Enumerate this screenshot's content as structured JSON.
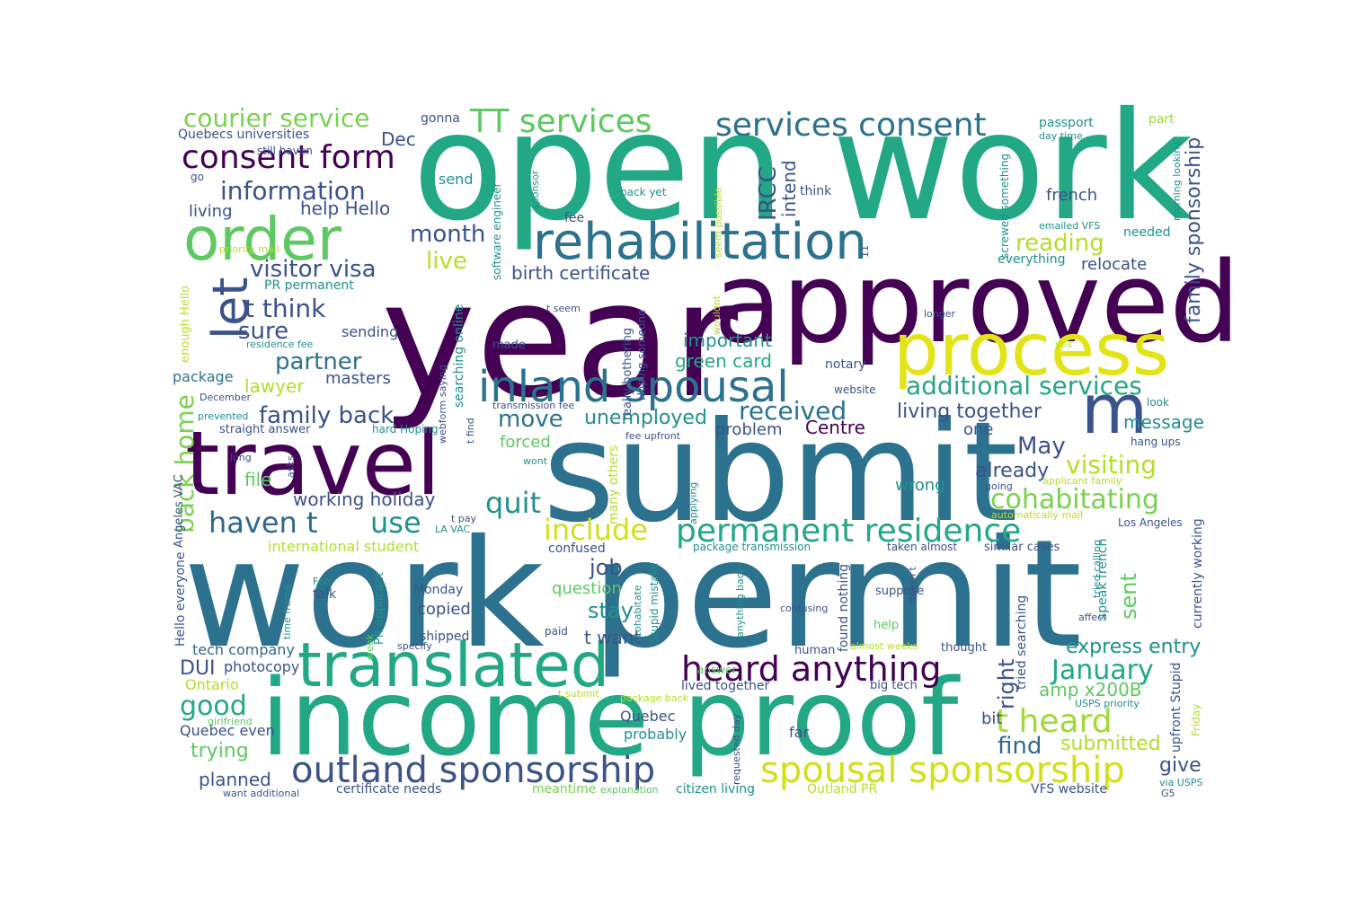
{
  "palette": {
    "dark_purple": "#440154",
    "indigo": "#3b528b",
    "blue": "#31688e",
    "teal": "#21918c",
    "green": "#22a884",
    "light_green": "#5ec962",
    "lime": "#a0da39",
    "yellow": "#e2e418"
  },
  "words": [
    {
      "text": "open work",
      "color": "#22a884"
    },
    {
      "text": "year",
      "color": "#440154"
    },
    {
      "text": "approved",
      "color": "#440154"
    },
    {
      "text": "work permit",
      "color": "#2c728e"
    },
    {
      "text": "submit",
      "color": "#2c728e"
    },
    {
      "text": "income proof",
      "color": "#22a884"
    },
    {
      "text": "travel",
      "color": "#440154"
    },
    {
      "text": "process",
      "color": "#e2e418"
    },
    {
      "text": "translated",
      "color": "#22a884"
    },
    {
      "text": "order",
      "color": "#5ec962"
    },
    {
      "text": "rehabilitation",
      "color": "#2c728e"
    },
    {
      "text": "inland spousal",
      "color": "#2c728e"
    },
    {
      "text": "m",
      "color": "#3b528b"
    },
    {
      "text": "let",
      "color": "#3b528b"
    },
    {
      "text": "spousal sponsorship",
      "color": "#d0e11c"
    },
    {
      "text": "outland sponsorship",
      "color": "#3b528b"
    },
    {
      "text": "heard anything",
      "color": "#440154"
    },
    {
      "text": "permanent residence",
      "color": "#22a884"
    },
    {
      "text": "services consent",
      "color": "#2c728e"
    },
    {
      "text": "TT services",
      "color": "#5ec962"
    },
    {
      "text": "consent form",
      "color": "#440154"
    },
    {
      "text": "courier service",
      "color": "#7ad151"
    },
    {
      "text": "information",
      "color": "#3b528b"
    },
    {
      "text": "additional services",
      "color": "#22a884"
    },
    {
      "text": "haven t",
      "color": "#31688e"
    },
    {
      "text": "use",
      "color": "#21918c"
    },
    {
      "text": "quit",
      "color": "#21918c"
    },
    {
      "text": "include",
      "color": "#d0e11c"
    },
    {
      "text": "cohabitating",
      "color": "#7ad151"
    },
    {
      "text": "visiting",
      "color": "#b5de2b"
    },
    {
      "text": "t heard",
      "color": "#a0da39"
    },
    {
      "text": "January",
      "color": "#22a884"
    },
    {
      "text": "back home",
      "color": "#7ad151"
    },
    {
      "text": "received",
      "color": "#2c728e"
    },
    {
      "text": "move",
      "color": "#2c728e"
    },
    {
      "text": "t think",
      "color": "#3b528b"
    },
    {
      "text": "family back",
      "color": "#3b528b"
    },
    {
      "text": "partner",
      "color": "#2c728e"
    },
    {
      "text": "sure",
      "color": "#3b528b"
    },
    {
      "text": "visitor visa",
      "color": "#3b528b"
    },
    {
      "text": "month",
      "color": "#3b528b"
    },
    {
      "text": "live",
      "color": "#b5de2b"
    },
    {
      "text": "reading",
      "color": "#b5de2b"
    },
    {
      "text": "IRCC",
      "color": "#3b528b"
    },
    {
      "text": "family sponsorship",
      "color": "#3b528b"
    },
    {
      "text": "living together",
      "color": "#3b528b"
    },
    {
      "text": "unemployed",
      "color": "#21918c"
    },
    {
      "text": "May",
      "color": "#3b528b"
    },
    {
      "text": "good",
      "color": "#22a884"
    },
    {
      "text": "right",
      "color": "#3b528b"
    },
    {
      "text": "find",
      "color": "#31688e"
    },
    {
      "text": "job",
      "color": "#3b528b"
    },
    {
      "text": "stay",
      "color": "#21918c"
    },
    {
      "text": "sent",
      "color": "#5ec962"
    },
    {
      "text": "trying",
      "color": "#5ec962"
    },
    {
      "text": "give",
      "color": "#3b528b"
    },
    {
      "text": "already",
      "color": "#3b528b"
    },
    {
      "text": "express entry",
      "color": "#21918c"
    },
    {
      "text": "submitted",
      "color": "#b5de2b"
    },
    {
      "text": "amp x200B",
      "color": "#5ec962"
    },
    {
      "text": "working holiday",
      "color": "#3b528b"
    },
    {
      "text": "birth certificate",
      "color": "#3b528b"
    },
    {
      "text": "green card",
      "color": "#22a884"
    },
    {
      "text": "important",
      "color": "#21918c"
    },
    {
      "text": "DUI",
      "color": "#3b528b"
    },
    {
      "text": "planned",
      "color": "#3b528b"
    },
    {
      "text": "Dec",
      "color": "#3b528b"
    },
    {
      "text": "help Hello",
      "color": "#3b528b"
    },
    {
      "text": "intend",
      "color": "#3b528b"
    },
    {
      "text": "french",
      "color": "#3b528b"
    },
    {
      "text": "relocate",
      "color": "#3b528b"
    },
    {
      "text": "message",
      "color": "#21918c"
    },
    {
      "text": "lawyer",
      "color": "#b5de2b"
    },
    {
      "text": "file",
      "color": "#5ec962"
    },
    {
      "text": "t want",
      "color": "#3b528b"
    },
    {
      "text": "problem",
      "color": "#3b528b"
    },
    {
      "text": "Centre",
      "color": "#440154"
    },
    {
      "text": "copied",
      "color": "#3b528b"
    },
    {
      "text": "forced",
      "color": "#5ec962"
    },
    {
      "text": "question",
      "color": "#5ec962"
    },
    {
      "text": "living",
      "color": "#3b528b"
    },
    {
      "text": "masters",
      "color": "#3b528b"
    },
    {
      "text": "wrong",
      "color": "#21918c"
    },
    {
      "text": "one",
      "color": "#3b528b"
    },
    {
      "text": "bit",
      "color": "#3b528b"
    },
    {
      "text": "sending",
      "color": "#3b528b"
    },
    {
      "text": "package",
      "color": "#2c728e"
    },
    {
      "text": "photocopy",
      "color": "#3b528b"
    },
    {
      "text": "tech company",
      "color": "#31688e"
    },
    {
      "text": "Ontario",
      "color": "#b5de2b"
    },
    {
      "text": "Quebec even",
      "color": "#3b528b"
    },
    {
      "text": "Quebec",
      "color": "#3b528b"
    },
    {
      "text": "probably",
      "color": "#21918c"
    },
    {
      "text": "far",
      "color": "#3b528b"
    },
    {
      "text": "certificate needs",
      "color": "#3b528b"
    },
    {
      "text": "meantime",
      "color": "#7ad151"
    },
    {
      "text": "VFS website",
      "color": "#3b528b"
    },
    {
      "text": "Outland PR",
      "color": "#b5de2b"
    },
    {
      "text": "citizen living",
      "color": "#21918c"
    },
    {
      "text": "international student",
      "color": "#b5de2b"
    },
    {
      "text": "confused",
      "color": "#3b528b"
    },
    {
      "text": "Monday",
      "color": "#3b528b"
    },
    {
      "text": "shipped",
      "color": "#3b528b"
    },
    {
      "text": "talk",
      "color": "#3b528b"
    },
    {
      "text": "Hello everyone",
      "color": "#3b528b"
    },
    {
      "text": "Quebecs universities",
      "color": "#3b528b"
    },
    {
      "text": "gonna",
      "color": "#3b528b"
    },
    {
      "text": "send",
      "color": "#21918c"
    },
    {
      "text": "still haven",
      "color": "#3b528b"
    },
    {
      "text": "go",
      "color": "#3b528b"
    },
    {
      "text": "PR permanent",
      "color": "#21918c"
    },
    {
      "text": "passport",
      "color": "#21918c"
    },
    {
      "text": "part",
      "color": "#a0da39"
    },
    {
      "text": "day time",
      "color": "#21918c"
    },
    {
      "text": "think",
      "color": "#3b528b"
    },
    {
      "text": "fee",
      "color": "#3b528b"
    },
    {
      "text": "back yet",
      "color": "#21918c"
    },
    {
      "text": "needed",
      "color": "#21918c"
    },
    {
      "text": "everything",
      "color": "#21918c"
    },
    {
      "text": "emailed VFS",
      "color": "#21918c"
    },
    {
      "text": "notary",
      "color": "#3b528b"
    },
    {
      "text": "website",
      "color": "#3b528b"
    },
    {
      "text": "look",
      "color": "#21918c"
    },
    {
      "text": "hang ups",
      "color": "#3b528b"
    },
    {
      "text": "straight answer",
      "color": "#3b528b"
    },
    {
      "text": "hard Hoping",
      "color": "#21918c"
    },
    {
      "text": "transmission fee",
      "color": "#3b528b"
    },
    {
      "text": "fee upfront",
      "color": "#3b528b"
    },
    {
      "text": "Los Angeles",
      "color": "#3b528b"
    },
    {
      "text": "similar cases",
      "color": "#3b528b"
    },
    {
      "text": "taken almost",
      "color": "#3b528b"
    },
    {
      "text": "package transmission",
      "color": "#21918c"
    },
    {
      "text": "suppose",
      "color": "#3b528b"
    },
    {
      "text": "help",
      "color": "#5ec962"
    },
    {
      "text": "human",
      "color": "#3b528b"
    },
    {
      "text": "thought",
      "color": "#3b528b"
    },
    {
      "text": "answer",
      "color": "#5ec962"
    },
    {
      "text": "lived together",
      "color": "#3b528b"
    },
    {
      "text": "big tech",
      "color": "#3b528b"
    },
    {
      "text": "almost weeks",
      "color": "#b5de2b"
    },
    {
      "text": "confusing",
      "color": "#3b528b"
    },
    {
      "text": "explanation",
      "color": "#5ec962"
    },
    {
      "text": "residence fee",
      "color": "#21918c"
    },
    {
      "text": "December",
      "color": "#3b528b"
    },
    {
      "text": "prevented",
      "color": "#21918c"
    },
    {
      "text": "priority mail",
      "color": "#b5de2b"
    },
    {
      "text": "paid",
      "color": "#3b528b"
    },
    {
      "text": "wont",
      "color": "#21918c"
    },
    {
      "text": "applicant family",
      "color": "#b5de2b"
    },
    {
      "text": "going",
      "color": "#3b528b"
    },
    {
      "text": "automatically mail",
      "color": "#b5de2b"
    },
    {
      "text": "yes",
      "color": "#b5de2b"
    },
    {
      "text": "longer",
      "color": "#3b528b"
    },
    {
      "text": "t seem",
      "color": "#3b528b"
    },
    {
      "text": "made",
      "color": "#3b528b"
    },
    {
      "text": "t pay",
      "color": "#3b528b"
    },
    {
      "text": "LA VAC",
      "color": "#21918c"
    },
    {
      "text": "Angeles VAC",
      "color": "#3b528b"
    },
    {
      "text": "long",
      "color": "#3b528b"
    },
    {
      "text": "girlfriend",
      "color": "#5ec962"
    },
    {
      "text": "want additional",
      "color": "#3b528b"
    },
    {
      "text": "t submit",
      "color": "#b5de2b"
    },
    {
      "text": "package back",
      "color": "#b5de2b"
    },
    {
      "text": "specify",
      "color": "#3b528b"
    },
    {
      "text": "Feb",
      "color": "#21918c"
    },
    {
      "text": "affect",
      "color": "#3b528b"
    },
    {
      "text": "USPS priority",
      "color": "#21918c"
    },
    {
      "text": "via USPS",
      "color": "#21918c"
    },
    {
      "text": "G5",
      "color": "#3b528b"
    },
    {
      "text": "enough Hello",
      "color": "#b5de2b"
    },
    {
      "text": "webform saying",
      "color": "#3b528b"
    },
    {
      "text": "searching online",
      "color": "#21918c"
    },
    {
      "text": "t find",
      "color": "#3b528b"
    },
    {
      "text": "software engineer",
      "color": "#21918c"
    },
    {
      "text": "sponsor",
      "color": "#21918c"
    },
    {
      "text": "really bothering",
      "color": "#3b528b"
    },
    {
      "text": "Hoping someone",
      "color": "#3b528b"
    },
    {
      "text": "seem possible",
      "color": "#b5de2b"
    },
    {
      "text": "wouldnt",
      "color": "#b5de2b"
    },
    {
      "text": "11",
      "color": "#3b528b"
    },
    {
      "text": "screwed something",
      "color": "#21918c"
    },
    {
      "text": "morning looking",
      "color": "#21918c"
    },
    {
      "text": "many others",
      "color": "#b5de2b"
    },
    {
      "text": "Stupid mistake",
      "color": "#21918c"
    },
    {
      "text": "cohabitate",
      "color": "#21918c"
    },
    {
      "text": "anything back",
      "color": "#21918c"
    },
    {
      "text": "requested day",
      "color": "#3b528b"
    },
    {
      "text": "found nothing",
      "color": "#3b528b"
    },
    {
      "text": "doesn t",
      "color": "#3b528b"
    },
    {
      "text": "tried searching",
      "color": "#3b528b"
    },
    {
      "text": "speak french",
      "color": "#21918c"
    },
    {
      "text": "tried calling",
      "color": "#21918c"
    },
    {
      "text": "currently working",
      "color": "#3b528b"
    },
    {
      "text": "upfront Stupid",
      "color": "#3b528b"
    },
    {
      "text": "Friday",
      "color": "#b5de2b"
    },
    {
      "text": "time frame",
      "color": "#21918c"
    },
    {
      "text": "PR applicant",
      "color": "#21918c"
    },
    {
      "text": "week",
      "color": "#5ec962"
    },
    {
      "text": "asks",
      "color": "#3b528b"
    },
    {
      "text": "applying",
      "color": "#21918c"
    }
  ]
}
